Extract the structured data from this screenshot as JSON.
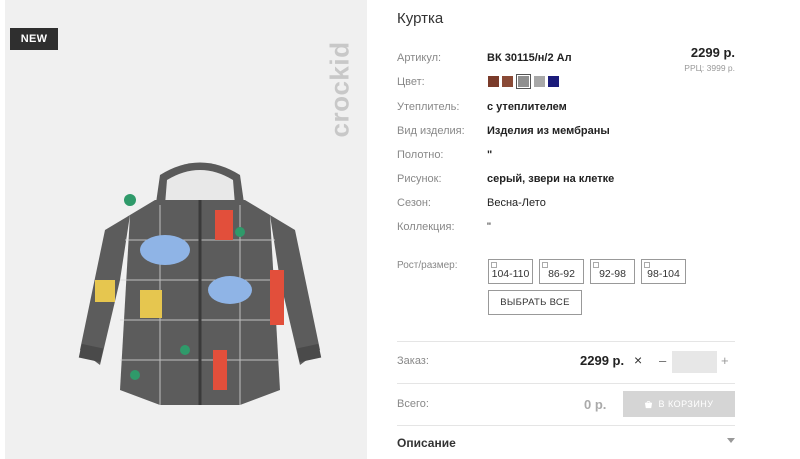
{
  "image": {
    "badge": "NEW",
    "brand": "crockid"
  },
  "product": {
    "title": "Куртка",
    "price": "2299 р.",
    "rrp": "РРЦ: 3999 р.",
    "rows": [
      {
        "label": "Артикул:",
        "value": "ВК 30115/н/2 Ал"
      },
      {
        "label": "Цвет:",
        "value": ""
      },
      {
        "label": "Утеплитель:",
        "value": "с утеплителем"
      },
      {
        "label": "Вид изделия:",
        "value": "Изделия из мембраны"
      },
      {
        "label": "Полотно:",
        "value": "\""
      },
      {
        "label": "Рисунок:",
        "value": "серый, звери на клетке"
      },
      {
        "label": "Сезон:",
        "value": "Весна-Лето"
      },
      {
        "label": "Коллекция:",
        "value": "\""
      }
    ],
    "colors": [
      "#7a3b2a",
      "#8a4a36",
      "#8f8f8f",
      "#a8a8a8",
      "#1b1b7a"
    ],
    "selected_color_index": 2,
    "size_label": "Рост/размер:",
    "sizes": [
      "104-110",
      "86-92",
      "92-98",
      "98-104"
    ],
    "select_all": "ВЫБРАТЬ ВСЕ"
  },
  "order": {
    "label": "Заказ:",
    "price": "2299 р.",
    "times": "×",
    "minus": "–",
    "plus": "+",
    "quantity": ""
  },
  "total": {
    "label": "Всего:",
    "value": "0 р.",
    "cart_button": "В КОРЗИНУ"
  },
  "description": {
    "label": "Описание"
  }
}
